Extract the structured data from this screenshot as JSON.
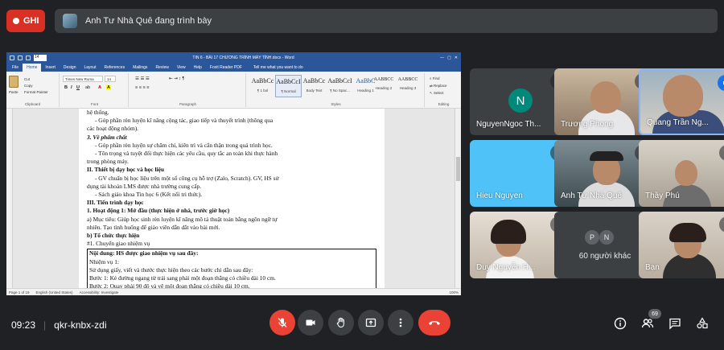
{
  "record": {
    "label": "GHI"
  },
  "presenting": {
    "text": "Anh Tư Nhà Quê đang trình bày"
  },
  "word": {
    "title": "TIN 6 - BÀI 17 CHƯƠNG TRÌNH MÁY TÍNH.docx - Word",
    "font_size": "14",
    "tabs": [
      "File",
      "Home",
      "Insert",
      "Design",
      "Layout",
      "References",
      "Mailings",
      "Review",
      "View",
      "Help",
      "Foxit Reader PDF"
    ],
    "tell_me": "Tell me what you want to do",
    "clipboard": {
      "paste": "Paste",
      "cut": "Cut",
      "copy": "Copy",
      "format_painter": "Format Painter",
      "label": "Clipboard"
    },
    "font": {
      "name": "Times New Roma",
      "size": "14",
      "label": "Font"
    },
    "paragraph_label": "Paragraph",
    "styles": [
      {
        "sample": "AaBbCc",
        "name": "¶ 1 bol"
      },
      {
        "sample": "AaBbCcI",
        "name": "¶ Normal"
      },
      {
        "sample": "AaBbCc",
        "name": "Body Text"
      },
      {
        "sample": "AaBbCcI",
        "name": "¶ No Spac..."
      },
      {
        "sample": "AaBbC",
        "name": "Heading 1"
      },
      {
        "sample": "AABBCC",
        "name": "Heading 2"
      },
      {
        "sample": "AABBCC",
        "name": "Heading 3"
      }
    ],
    "styles_label": "Styles",
    "editing": {
      "find": "Find",
      "replace": "Replace",
      "select": "Select",
      "label": "Editing"
    },
    "lines": [
      {
        "t": "hệ thống.",
        "c": ""
      },
      {
        "t": "-       Góp phần rèn luyện kĩ năng cộng tác, giao tiếp và thuyết trình (thông qua",
        "c": "ind"
      },
      {
        "t": "các hoạt động nhóm).",
        "c": ""
      },
      {
        "t": "3. Về phẩm chất",
        "c": "bi"
      },
      {
        "t": "-       Góp phần rèn luyện sự chăm chỉ, kiên trì và cẩn thận trong quá trình học.",
        "c": "ind"
      },
      {
        "t": "-       Tôn trọng và tuyệt đối thực hiện các yêu cầu, quy tắc an toàn khi thực hành",
        "c": "ind"
      },
      {
        "t": "trong phòng máy.",
        "c": ""
      },
      {
        "t": "II. Thiết bị dạy học và học liệu",
        "c": "b"
      },
      {
        "t": "-       GV chuẩn bị học liệu trên một số công cụ hỗ trợ (Zalo, Scratch). GV, HS sử",
        "c": "ind"
      },
      {
        "t": "dụng tài khoản LMS được nhà trường cung cấp.",
        "c": ""
      },
      {
        "t": "-       Sách giáo khoa Tin học 6 (Kết nối tri thức).",
        "c": "ind"
      },
      {
        "t": "III. Tiến trình dạy học",
        "c": "b"
      },
      {
        "t": "1. Hoạt động 1: Mở đầu (thực hiện ở nhà, trước giờ học)",
        "c": "b"
      },
      {
        "t": "a) Mục tiêu: Giúp học sinh rèn luyện kĩ năng mô tả thuật toán bằng ngôn ngữ tự",
        "c": ""
      },
      {
        "t": "nhiên. Tạo tình huống để giáo viên dẫn dắt vào bài mới.",
        "c": ""
      },
      {
        "t": "b) Tổ chức thực hiện",
        "c": "b"
      },
      {
        "t": "#1. Chuyển giao nhiệm vụ",
        "c": ""
      }
    ],
    "box_lines": [
      {
        "t": "Nội dung: HS được giao nhiệm vụ sau đây:",
        "c": "b"
      },
      {
        "t": "Nhiệm vụ 1:",
        "c": ""
      },
      {
        "t": "Sử dụng giấy, viết và thước thực hiện theo các bước chỉ dẫn sau đây:",
        "c": ""
      },
      {
        "t": "Bước 1: Kẻ đường ngang từ trái sang phải một đoạn thẳng có chiều dài 10 cm.",
        "c": ""
      },
      {
        "t": "Bước 2: Quay phải 90 độ và vẽ một đoạn thẳng có chiều dài 10 cm.",
        "c": ""
      }
    ],
    "status": {
      "page": "Page 1 of 19",
      "words": "",
      "lang": "English (United States)",
      "access": "Accessibility: Investigate",
      "zoom": "100%"
    }
  },
  "tiles": [
    {
      "name": "NguyenNgoc Th...",
      "initial": "N"
    },
    {
      "name": "Trương Phong"
    },
    {
      "name": "Quang Trần Ng..."
    },
    {
      "name": "Hieu Nguyen"
    },
    {
      "name": "Anh Tư Nhà Quê"
    },
    {
      "name": "Thầy Phú"
    },
    {
      "name": "Duy Nguyễn H..."
    },
    {
      "name": "60 người khác",
      "a1": "P",
      "a2": "N"
    },
    {
      "name": "Bạn"
    }
  ],
  "meeting": {
    "time": "09:23",
    "code": "qkr-knbx-zdi",
    "people_count": "69"
  },
  "colors": {
    "bg": "#202124",
    "end_call": "#ea4335",
    "word_blue": "#2b579a",
    "tile_teal": "#00897b",
    "tile_blue": "#4fc3f7"
  }
}
